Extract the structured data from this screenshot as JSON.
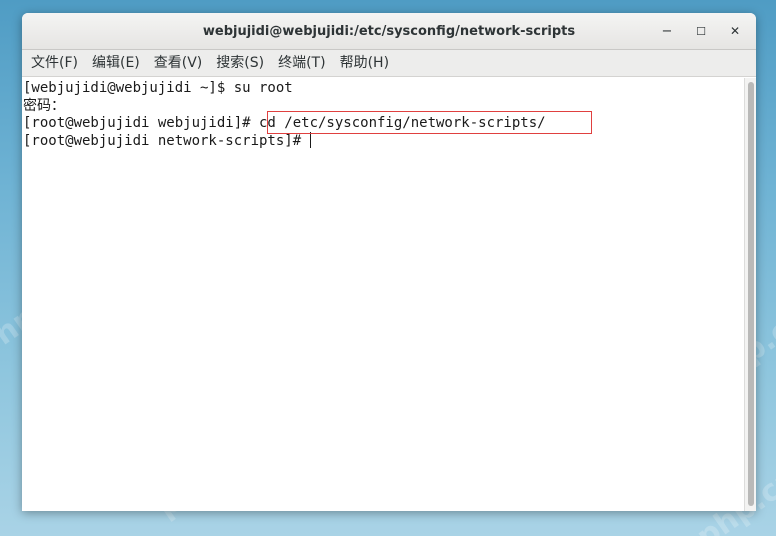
{
  "window": {
    "title": "webjujidi@webjujidi:/etc/sysconfig/network-scripts",
    "controls": {
      "minimize": "−",
      "maximize": "☐",
      "close": "✕"
    }
  },
  "menubar": {
    "items": [
      {
        "label": "文件(F)"
      },
      {
        "label": "编辑(E)"
      },
      {
        "label": "查看(V)"
      },
      {
        "label": "搜索(S)"
      },
      {
        "label": "终端(T)"
      },
      {
        "label": "帮助(H)"
      }
    ]
  },
  "terminal": {
    "lines": [
      "[webjujidi@webjujidi ~]$ su root",
      "密码：",
      "[root@webjujidi webjujidi]# cd /etc/sysconfig/network-scripts/",
      "[root@webjujidi network-scripts]# "
    ],
    "highlighted_command": "cd /etc/sysconfig/network-scripts/"
  },
  "watermark": {
    "text": "php.cn"
  },
  "colors": {
    "highlight_border": "#e0403f",
    "terminal_bg": "#ffffff",
    "text": "#1a1a1a"
  }
}
